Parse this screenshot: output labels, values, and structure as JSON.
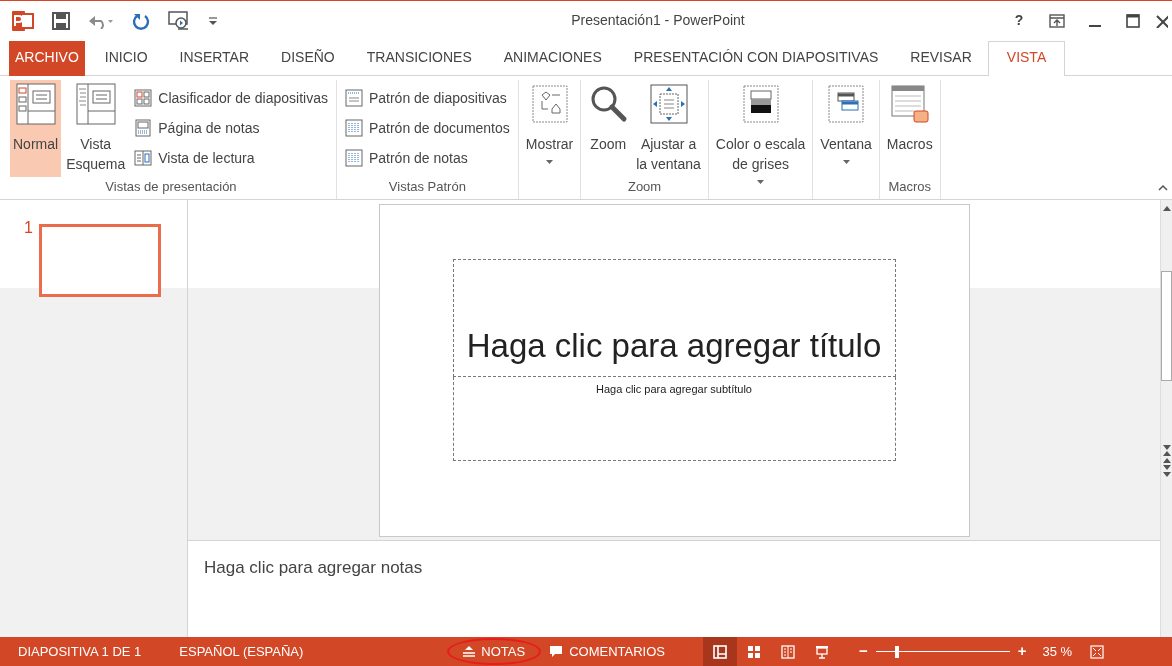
{
  "window": {
    "title": "Presentación1 - PowerPoint",
    "help": "?"
  },
  "tabs": [
    {
      "label": "ARCHIVO",
      "kind": "file",
      "selected": false
    },
    {
      "label": "INICIO",
      "kind": "tab",
      "selected": false
    },
    {
      "label": "INSERTAR",
      "kind": "tab",
      "selected": false
    },
    {
      "label": "DISEÑO",
      "kind": "tab",
      "selected": false
    },
    {
      "label": "TRANSICIONES",
      "kind": "tab",
      "selected": false
    },
    {
      "label": "ANIMACIONES",
      "kind": "tab",
      "selected": false
    },
    {
      "label": "PRESENTACIÓN CON DIAPOSITIVAS",
      "kind": "tab",
      "selected": false
    },
    {
      "label": "REVISAR",
      "kind": "tab",
      "selected": false
    },
    {
      "label": "VISTA",
      "kind": "tab",
      "selected": true
    }
  ],
  "ribbon": {
    "groups": [
      {
        "label": "Vistas de presentación",
        "items": [
          {
            "kind": "large",
            "label": "Normal",
            "selected": true
          },
          {
            "kind": "large",
            "label": "Vista\nEsquema",
            "selected": false
          },
          {
            "kind": "small",
            "label": "Clasificador de diapositivas",
            "selected": false
          },
          {
            "kind": "small",
            "label": "Página de notas",
            "selected": false
          },
          {
            "kind": "small",
            "label": "Vista de lectura",
            "selected": false
          }
        ]
      },
      {
        "label": "Vistas Patrón",
        "items": [
          {
            "kind": "small",
            "label": "Patrón de diapositivas",
            "selected": false
          },
          {
            "kind": "small",
            "label": "Patrón de documentos",
            "selected": false
          },
          {
            "kind": "small",
            "label": "Patrón de notas",
            "selected": false
          }
        ]
      },
      {
        "items": [
          {
            "kind": "large",
            "label": "Mostrar",
            "dropdown": true,
            "selected": false
          }
        ]
      },
      {
        "label": "Zoom",
        "items": [
          {
            "kind": "large",
            "label": "Zoom",
            "selected": false
          },
          {
            "kind": "large",
            "label": "Ajustar a\nla ventana",
            "selected": false
          }
        ]
      },
      {
        "items": [
          {
            "kind": "large",
            "label": "Color o escala\nde grises",
            "dropdown": true,
            "selected": false
          }
        ]
      },
      {
        "items": [
          {
            "kind": "large",
            "label": "Ventana",
            "dropdown": true,
            "selected": false
          }
        ]
      },
      {
        "label": "Macros",
        "items": [
          {
            "kind": "large",
            "label": "Macros",
            "selected": false
          }
        ]
      }
    ]
  },
  "thumbnails": [
    {
      "number": "1",
      "selected": true
    }
  ],
  "slide": {
    "title": "Haga clic para agregar título",
    "subtitle": "Haga clic para agregar subtítulo"
  },
  "notes": {
    "placeholder": "Haga clic para agregar notas"
  },
  "status_bar": {
    "slide": "DIAPOSITIVA 1 DE 1",
    "language": "ESPAÑOL (ESPAÑA)",
    "notes": "NOTAS",
    "notes_highlighted": true,
    "comments": "COMENTARIOS",
    "views": [
      {
        "selected": true
      },
      {
        "selected": false
      },
      {
        "selected": false
      },
      {
        "selected": false
      }
    ],
    "zoom_out": "−",
    "zoom_in": "+",
    "zoom": {
      "level": 0.16
    },
    "zoom_reading": "35 %"
  }
}
